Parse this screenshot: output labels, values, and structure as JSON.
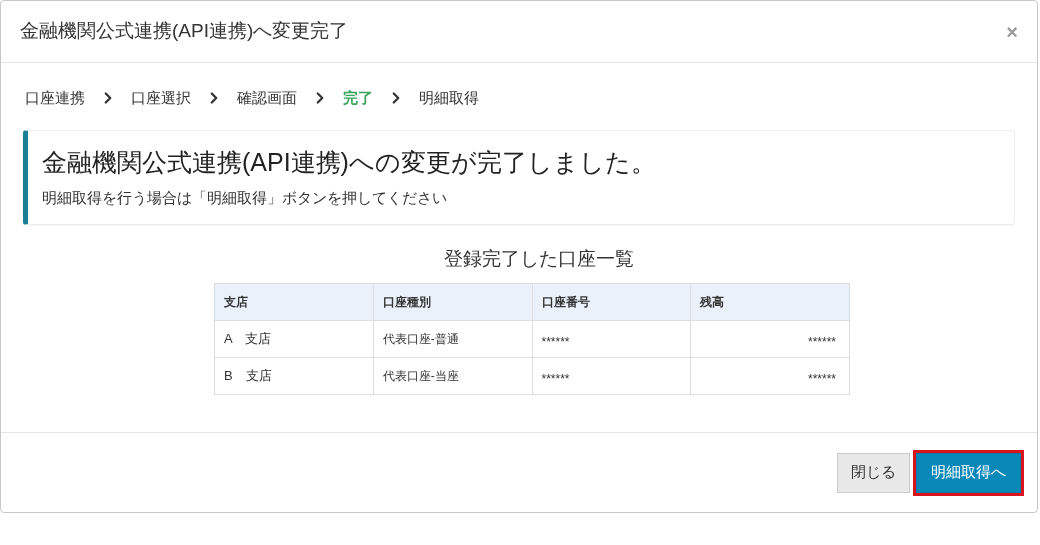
{
  "dialog": {
    "title": "金融機関公式連携(API連携)へ変更完了",
    "close": "×"
  },
  "steps": [
    {
      "label": "口座連携",
      "selected": false
    },
    {
      "label": "口座選択",
      "selected": false
    },
    {
      "label": "確認画面",
      "selected": false
    },
    {
      "label": "完了",
      "selected": true
    },
    {
      "label": "明細取得",
      "selected": false
    }
  ],
  "notice": {
    "heading": "金融機関公式連携(API連携)への変更が完了しました。",
    "message": "明細取得を行う場合は「明細取得」ボタンを押してください"
  },
  "table": {
    "title": "登録完了した口座一覧",
    "columns": [
      "支店",
      "口座種別",
      "口座番号",
      "残高"
    ],
    "rows": [
      [
        "A　支店",
        "代表口座-普通",
        "******",
        "******"
      ],
      [
        "B　支店",
        "代表口座-当座",
        "******",
        "******"
      ]
    ]
  },
  "buttons": [
    {
      "label": "閉じる",
      "kind": "secondary",
      "highlighted": false
    },
    {
      "label": "明細取得へ",
      "kind": "primary",
      "highlighted": true
    }
  ]
}
